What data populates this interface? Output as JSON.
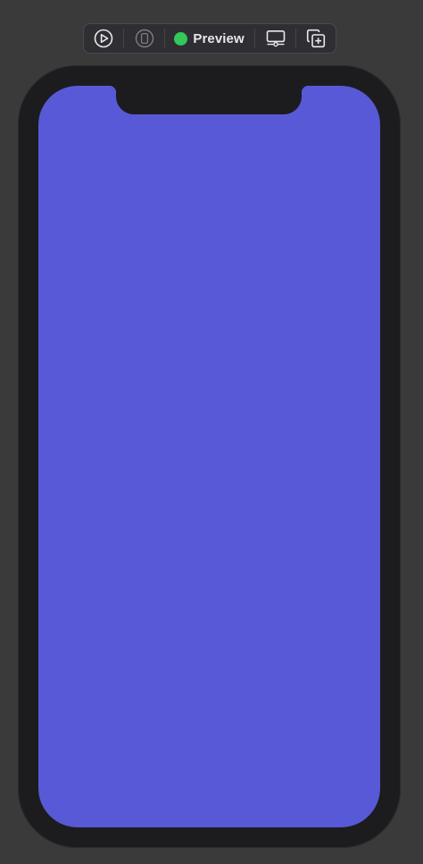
{
  "toolbar": {
    "preview_label": "Preview",
    "preview_status_color": "#34c759",
    "icons": {
      "play": "play-circle-icon",
      "device": "device-icon",
      "display": "display-settings-icon",
      "duplicate": "duplicate-add-icon"
    }
  },
  "device": {
    "screen_color": "#5859d6",
    "frame_color": "#1c1c1e"
  }
}
